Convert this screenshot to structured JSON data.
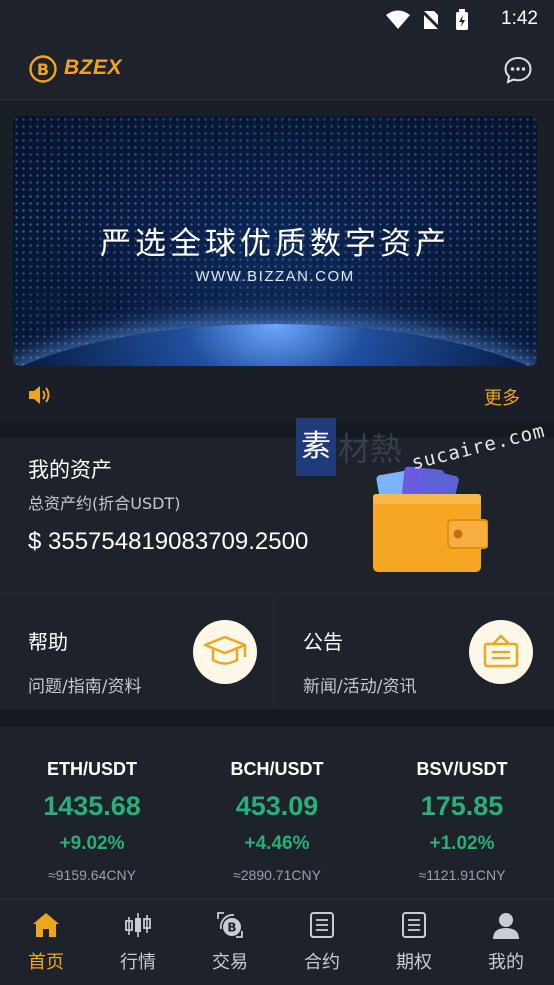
{
  "status_bar": {
    "time": "1:42"
  },
  "header": {
    "logo_text": "BZEX"
  },
  "banner": {
    "title": "严选全球优质数字资产",
    "url": "WWW.BIZZAN.COM"
  },
  "notice": {
    "more_label": "更多"
  },
  "assets": {
    "title": "我的资产",
    "subtitle": "总资产约(折合USDT)",
    "amount": "$ 355754819083709.2500"
  },
  "cards": [
    {
      "title": "帮助",
      "subtitle": "问题/指南/资料",
      "icon": "graduation-cap-icon"
    },
    {
      "title": "公告",
      "subtitle": "新闻/活动/资讯",
      "icon": "announcement-board-icon"
    }
  ],
  "markets": [
    {
      "pair": "ETH/USDT",
      "price": "1435.68",
      "change": "+9.02%",
      "cny": "≈9159.64CNY"
    },
    {
      "pair": "BCH/USDT",
      "price": "453.09",
      "change": "+4.46%",
      "cny": "≈2890.71CNY"
    },
    {
      "pair": "BSV/USDT",
      "price": "175.85",
      "change": "+1.02%",
      "cny": "≈1121.91CNY"
    }
  ],
  "tabs": [
    {
      "label": "首页",
      "icon": "home-icon",
      "active": true
    },
    {
      "label": "行情",
      "icon": "candlestick-icon",
      "active": false
    },
    {
      "label": "交易",
      "icon": "exchange-icon",
      "active": false
    },
    {
      "label": "合约",
      "icon": "contract-icon",
      "active": false
    },
    {
      "label": "期权",
      "icon": "options-icon",
      "active": false
    },
    {
      "label": "我的",
      "icon": "profile-icon",
      "active": false
    }
  ],
  "watermark": {
    "brand": "素",
    "brand2": "材熱",
    "site": "sucaire.com"
  },
  "colors": {
    "accent": "#f0a61a",
    "positive": "#27b07a",
    "background": "#1a1e26",
    "panel": "#1d222b"
  }
}
